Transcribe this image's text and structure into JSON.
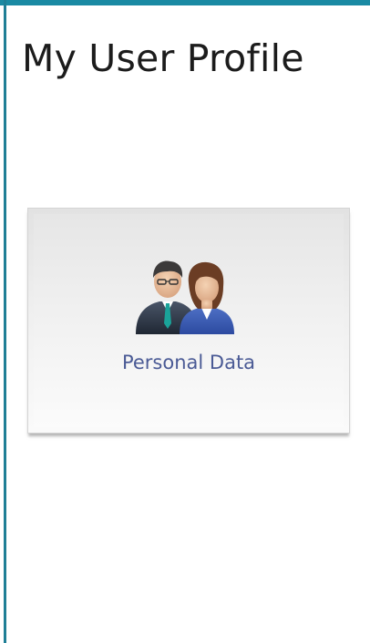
{
  "page": {
    "title": "My User Profile"
  },
  "tiles": [
    {
      "label": "Personal Data",
      "icon": "users-icon"
    }
  ],
  "colors": {
    "accent": "#1a8aa3",
    "tile_label": "#4a5a95"
  }
}
